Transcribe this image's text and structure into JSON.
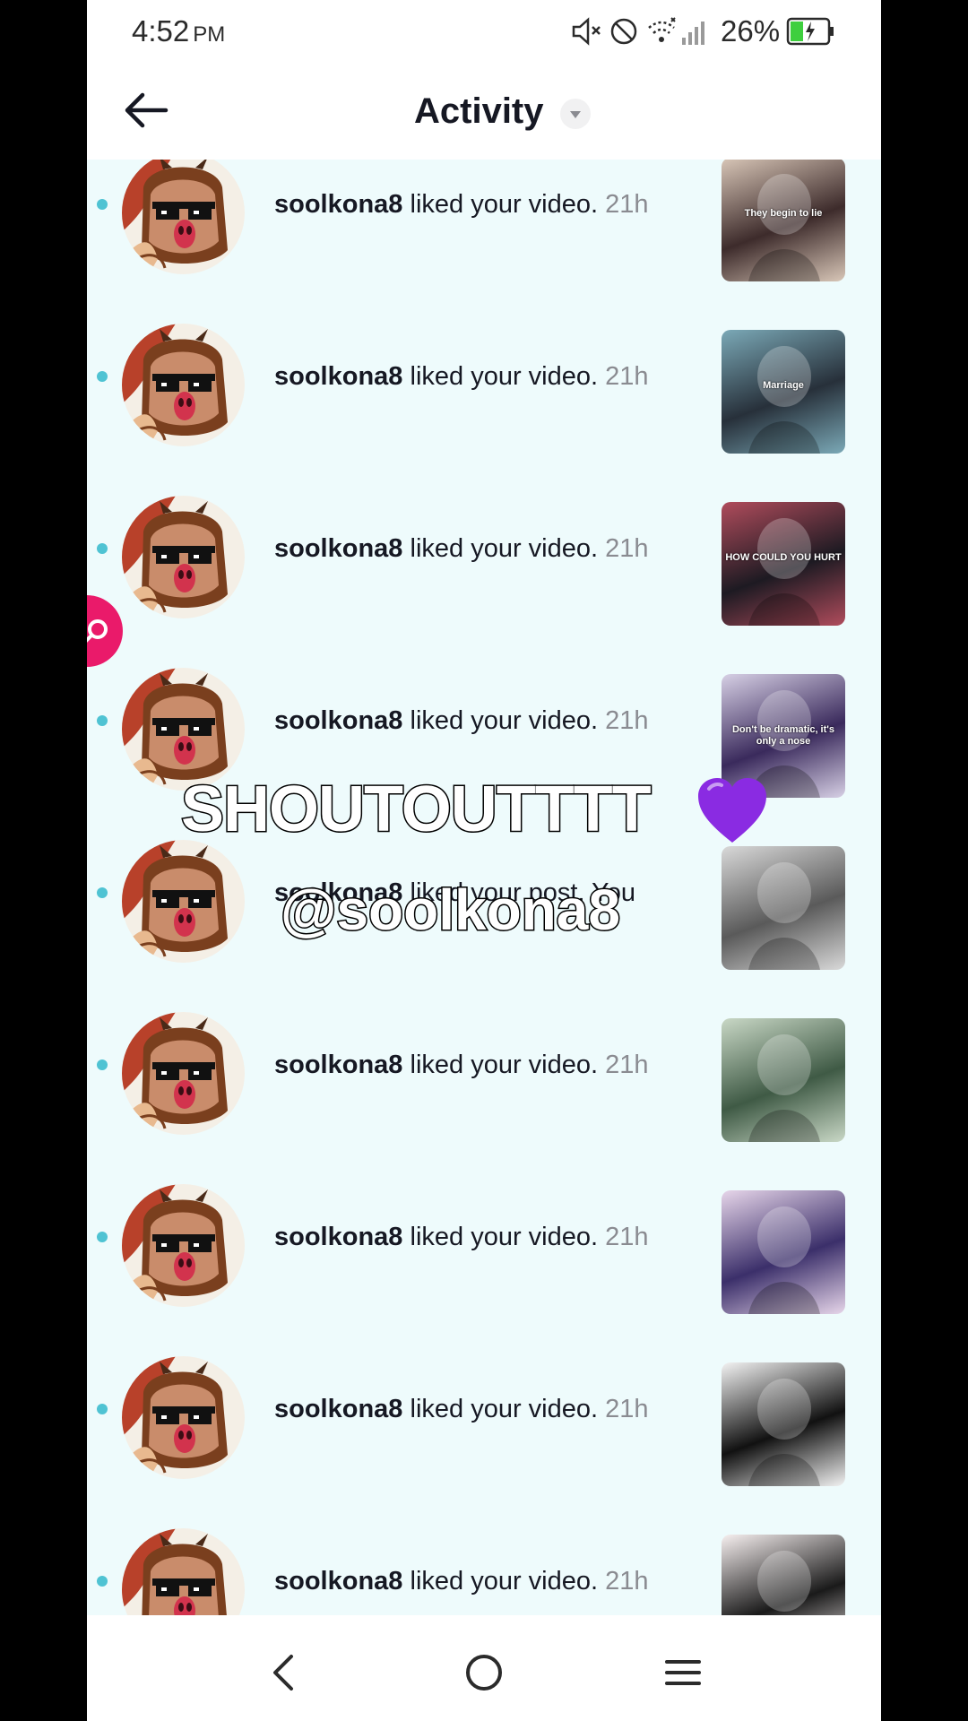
{
  "status_bar": {
    "time": "4:52",
    "ampm": "PM",
    "battery": "26%",
    "icons": [
      "mute-icon",
      "do-not-disturb-icon",
      "wifi-icon",
      "signal-icon",
      "battery-charging-icon"
    ]
  },
  "header": {
    "title": "Activity",
    "back_icon": "arrow-left-icon",
    "dropdown_icon": "caret-down-icon"
  },
  "notifications": [
    {
      "username": "soolkona8",
      "action": "liked your video.",
      "time": "21h",
      "thumb_caption": "They begin to lie",
      "thumb_colors": [
        "#3d2b2b",
        "#d9c7b8"
      ]
    },
    {
      "username": "soolkona8",
      "action": "liked your video.",
      "time": "21h",
      "thumb_caption": "Marriage",
      "thumb_colors": [
        "#27303a",
        "#7ba9b7"
      ]
    },
    {
      "username": "soolkona8",
      "action": "liked your video.",
      "time": "21h",
      "thumb_caption": "HOW COULD YOU HURT",
      "thumb_colors": [
        "#1d1a22",
        "#b04c5c"
      ]
    },
    {
      "username": "soolkona8",
      "action": "liked your video.",
      "time": "21h",
      "thumb_caption": "Don't be dramatic, it's only a nose",
      "thumb_colors": [
        "#3a2a5c",
        "#d7d0e5"
      ]
    },
    {
      "username": "soolkona8",
      "action": "liked your post. You",
      "time": "",
      "thumb_caption": "",
      "thumb_colors": [
        "#5a5a5a",
        "#d9d9d9"
      ]
    },
    {
      "username": "soolkona8",
      "action": "liked your video.",
      "time": "21h",
      "thumb_caption": "",
      "thumb_colors": [
        "#3f5a45",
        "#c9d8c6"
      ]
    },
    {
      "username": "soolkona8",
      "action": "liked your video.",
      "time": "21h",
      "thumb_caption": "",
      "thumb_colors": [
        "#3b2f6a",
        "#e7d6ea"
      ]
    },
    {
      "username": "soolkona8",
      "action": "liked your video.",
      "time": "21h",
      "thumb_caption": "",
      "thumb_colors": [
        "#111111",
        "#f3f3f3"
      ]
    },
    {
      "username": "soolkona8",
      "action": "liked your video.",
      "time": "21h",
      "thumb_caption": "",
      "thumb_colors": [
        "#1a1a1a",
        "#f7f0f0"
      ]
    }
  ],
  "overlay": {
    "line1": "SHOUTOUTTTT",
    "line2": "@soolkona8",
    "emoji": "purple-heart-icon"
  },
  "floating_button": {
    "icon": "search-icon",
    "color": "#ea1a6a"
  },
  "nav_bar": {
    "icons": [
      "nav-back-icon",
      "nav-home-icon",
      "nav-menu-icon"
    ]
  },
  "colors": {
    "list_background": "#eefbfc",
    "unread_dot": "#4fc3d3",
    "username": "#161823",
    "time": "#8a8b91"
  }
}
